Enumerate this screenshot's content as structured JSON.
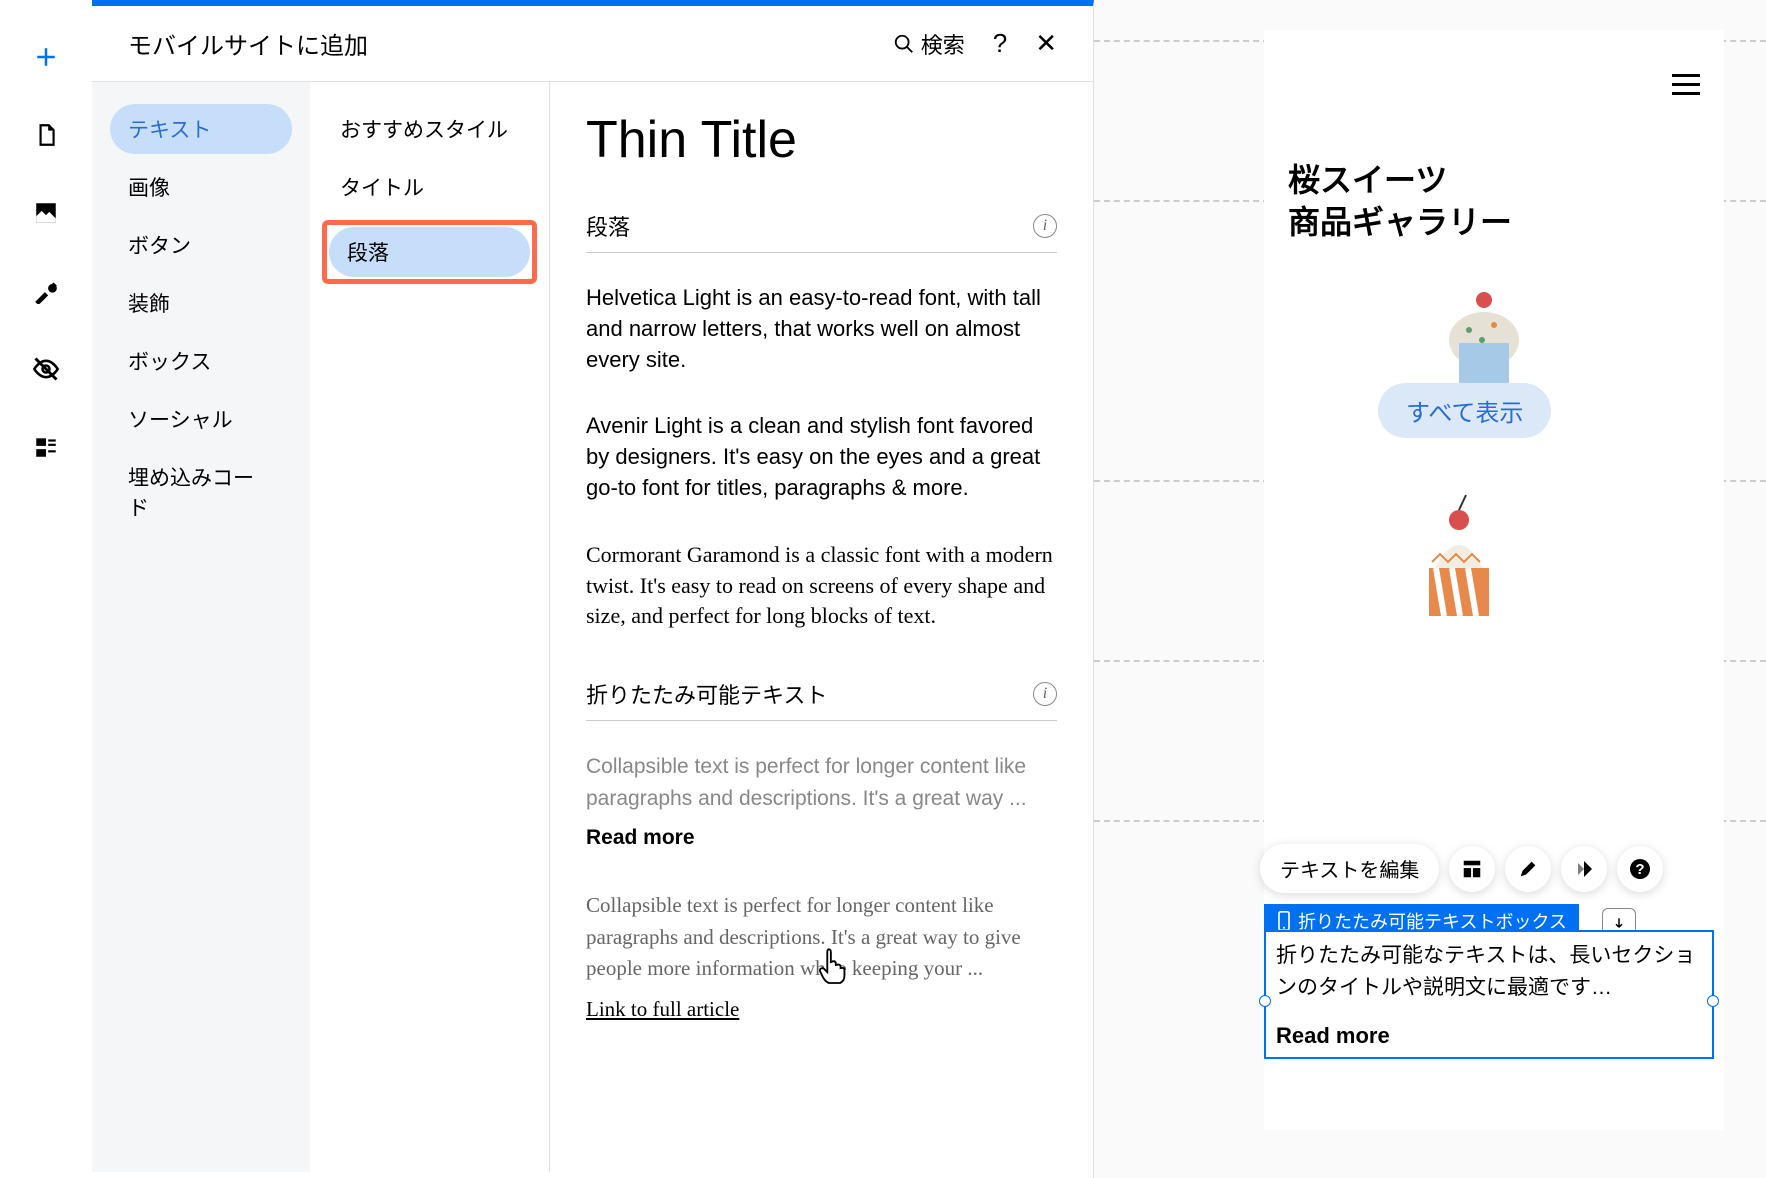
{
  "panel": {
    "title": "モバイルサイトに追加",
    "search_label": "検索"
  },
  "categories": {
    "items": [
      {
        "label": "テキスト",
        "active": true
      },
      {
        "label": "画像",
        "active": false
      },
      {
        "label": "ボタン",
        "active": false
      },
      {
        "label": "装飾",
        "active": false
      },
      {
        "label": "ボックス",
        "active": false
      },
      {
        "label": "ソーシャル",
        "active": false
      },
      {
        "label": "埋め込みコード",
        "active": false
      }
    ]
  },
  "subcategories": {
    "items": [
      {
        "label": "おすすめスタイル",
        "active": false
      },
      {
        "label": "タイトル",
        "active": false
      },
      {
        "label": "段落",
        "active": true,
        "highlighted": true
      }
    ]
  },
  "preview": {
    "thin_title": "Thin Title",
    "section1_label": "段落",
    "p1": "Helvetica Light is an easy-to-read font, with tall and narrow letters, that works well on almost every site.",
    "p2": "Avenir Light is a clean and stylish font favored by designers. It's easy on the eyes and a great go-to font for titles, paragraphs & more.",
    "p3": "Cormorant Garamond is a classic font with a modern twist. It's easy to read on screens of every shape and size, and perfect for long blocks of text.",
    "section2_label": "折りたたみ可能テキスト",
    "collapsible1": "Collapsible text is perfect for longer content like paragraphs and descriptions. It's a great way ...",
    "read_more": "Read more",
    "collapsible2": "Collapsible text is perfect for longer content like paragraphs and descriptions. It's a great way to give people more information while keeping your ...",
    "link_full": "Link to full article"
  },
  "mobile": {
    "title_line1": "桜スイーツ",
    "title_line2": "商品ギャラリー",
    "view_all": "すべて表示"
  },
  "floating_toolbar": {
    "edit_text": "テキストを編集"
  },
  "selected": {
    "label": "折りたたみ可能テキストボックス",
    "text": "折りたたみ可能なテキストは、長いセクションのタイトルや説明文に最適です…",
    "read_more": "Read more"
  }
}
